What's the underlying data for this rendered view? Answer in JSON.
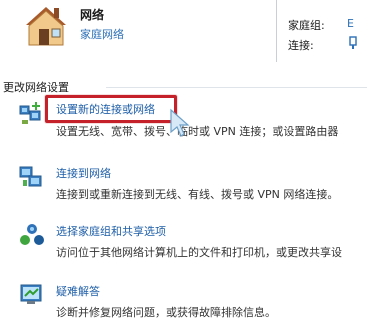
{
  "network": {
    "name": "网络",
    "type_link": "家庭网络",
    "homegroup_label": "家庭组:",
    "homegroup_value": "E",
    "connection_label": "连接:"
  },
  "section": {
    "title": "更改网络设置"
  },
  "tasks": [
    {
      "link": "设置新的连接或网络",
      "desc": "设置无线、宽带、拨号、临时或 VPN 连接；或设置路由器",
      "icon": "new-connection-icon"
    },
    {
      "link": "连接到网络",
      "desc": "连接到或重新连接到无线、有线、拨号或 VPN 网络连接。",
      "icon": "connect-network-icon"
    },
    {
      "link": "选择家庭组和共享选项",
      "desc": "访问位于其他网络计算机上的文件和打印机，或更改共享设",
      "icon": "homegroup-share-icon"
    },
    {
      "link": "疑难解答",
      "desc": "诊断并修复网络问题，或获得故障排除信息。",
      "icon": "troubleshoot-icon"
    }
  ]
}
